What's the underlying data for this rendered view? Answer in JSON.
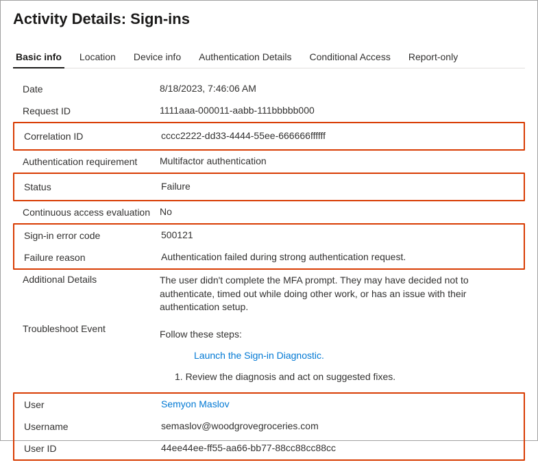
{
  "header": {
    "title": "Activity Details: Sign-ins"
  },
  "tabs": {
    "basic": "Basic info",
    "location": "Location",
    "device": "Device info",
    "auth": "Authentication Details",
    "ca": "Conditional Access",
    "report": "Report-only"
  },
  "rows": {
    "date": {
      "label": "Date",
      "value": "8/18/2023, 7:46:06 AM"
    },
    "request_id": {
      "label": "Request ID",
      "value": "1111aaa-000011-aabb-111bbbbb000"
    },
    "correlation_id": {
      "label": "Correlation ID",
      "value": "cccc2222-dd33-4444-55ee-666666ffffff"
    },
    "auth_req": {
      "label": "Authentication requirement",
      "value": "Multifactor authentication"
    },
    "status": {
      "label": "Status",
      "value": "Failure"
    },
    "cae": {
      "label": "Continuous access evaluation",
      "value": "No"
    },
    "error_code": {
      "label": "Sign-in error code",
      "value": "500121"
    },
    "failure_reason": {
      "label": "Failure reason",
      "value": "Authentication failed during strong authentication request."
    },
    "additional_details": {
      "label": "Additional Details",
      "value": "The user didn't complete the MFA prompt. They may have decided not to authenticate, timed out while doing other work, or has an issue with their authentication setup."
    },
    "troubleshoot": {
      "label": "Troubleshoot Event",
      "intro": "Follow these steps:",
      "link": "Launch the Sign-in Diagnostic.",
      "step1": "1. Review the diagnosis and act on suggested fixes."
    },
    "user": {
      "label": "User",
      "value": "Semyon Maslov"
    },
    "username": {
      "label": "Username",
      "value": "semaslov@woodgrovegroceries.com"
    },
    "user_id": {
      "label": "User ID",
      "value": "44ee44ee-ff55-aa66-bb77-88cc88cc88cc"
    }
  }
}
